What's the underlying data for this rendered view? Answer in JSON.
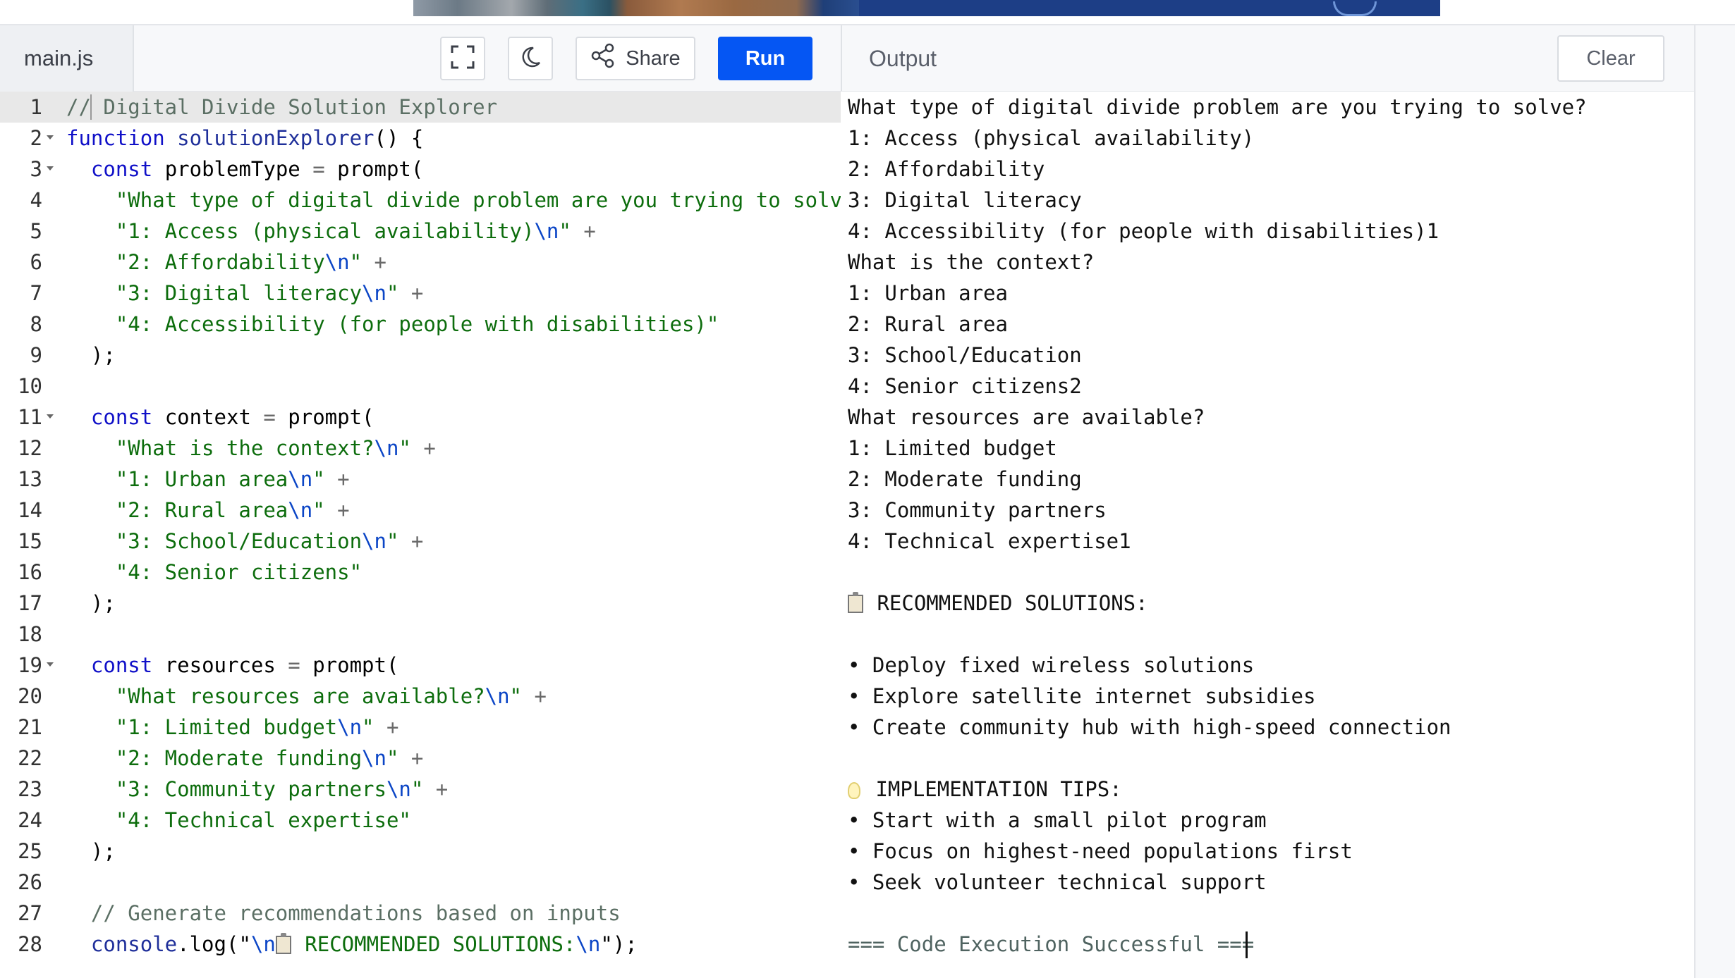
{
  "editor": {
    "file_tab": "main.js",
    "share_label": "Share",
    "run_label": "Run",
    "code_lines": [
      [
        [
          "c",
          "// Digital Divide Solution Explorer"
        ]
      ],
      [
        [
          "k",
          "function "
        ],
        [
          "d",
          "solutionExplorer"
        ],
        [
          "p",
          "() {"
        ]
      ],
      [
        [
          "p",
          "  "
        ],
        [
          "k",
          "const "
        ],
        [
          "p",
          "problemType "
        ],
        [
          "o",
          "= "
        ],
        [
          "p",
          "prompt("
        ]
      ],
      [
        [
          "s",
          "    \"What type of digital divide problem are you trying to solve?\\n\" +"
        ]
      ],
      [
        [
          "s",
          "    \"1: Access (physical availability)"
        ],
        [
          "e",
          "\\n"
        ],
        [
          "s",
          "\" "
        ],
        [
          "o",
          "+"
        ]
      ],
      [
        [
          "s",
          "    \"2: Affordability"
        ],
        [
          "e",
          "\\n"
        ],
        [
          "s",
          "\" "
        ],
        [
          "o",
          "+"
        ]
      ],
      [
        [
          "s",
          "    \"3: Digital literacy"
        ],
        [
          "e",
          "\\n"
        ],
        [
          "s",
          "\" "
        ],
        [
          "o",
          "+"
        ]
      ],
      [
        [
          "s",
          "    \"4: Accessibility (for people with disabilities)\""
        ]
      ],
      [
        [
          "p",
          "  );"
        ]
      ],
      [
        [
          "p",
          ""
        ]
      ],
      [
        [
          "p",
          "  "
        ],
        [
          "k",
          "const "
        ],
        [
          "p",
          "context "
        ],
        [
          "o",
          "= "
        ],
        [
          "p",
          "prompt("
        ]
      ],
      [
        [
          "s",
          "    \"What is the context?"
        ],
        [
          "e",
          "\\n"
        ],
        [
          "s",
          "\" "
        ],
        [
          "o",
          "+"
        ]
      ],
      [
        [
          "s",
          "    \"1: Urban area"
        ],
        [
          "e",
          "\\n"
        ],
        [
          "s",
          "\" "
        ],
        [
          "o",
          "+"
        ]
      ],
      [
        [
          "s",
          "    \"2: Rural area"
        ],
        [
          "e",
          "\\n"
        ],
        [
          "s",
          "\" "
        ],
        [
          "o",
          "+"
        ]
      ],
      [
        [
          "s",
          "    \"3: School/Education"
        ],
        [
          "e",
          "\\n"
        ],
        [
          "s",
          "\" "
        ],
        [
          "o",
          "+"
        ]
      ],
      [
        [
          "s",
          "    \"4: Senior citizens\""
        ]
      ],
      [
        [
          "p",
          "  );"
        ]
      ],
      [
        [
          "p",
          ""
        ]
      ],
      [
        [
          "p",
          "  "
        ],
        [
          "k",
          "const "
        ],
        [
          "p",
          "resources "
        ],
        [
          "o",
          "= "
        ],
        [
          "p",
          "prompt("
        ]
      ],
      [
        [
          "s",
          "    \"What resources are available?"
        ],
        [
          "e",
          "\\n"
        ],
        [
          "s",
          "\" "
        ],
        [
          "o",
          "+"
        ]
      ],
      [
        [
          "s",
          "    \"1: Limited budget"
        ],
        [
          "e",
          "\\n"
        ],
        [
          "s",
          "\" "
        ],
        [
          "o",
          "+"
        ]
      ],
      [
        [
          "s",
          "    \"2: Moderate funding"
        ],
        [
          "e",
          "\\n"
        ],
        [
          "s",
          "\" "
        ],
        [
          "o",
          "+"
        ]
      ],
      [
        [
          "s",
          "    \"3: Community partners"
        ],
        [
          "e",
          "\\n"
        ],
        [
          "s",
          "\" "
        ],
        [
          "o",
          "+"
        ]
      ],
      [
        [
          "s",
          "    \"4: Technical expertise\""
        ]
      ],
      [
        [
          "p",
          "  );"
        ]
      ],
      [
        [
          "p",
          ""
        ]
      ],
      [
        [
          "c",
          "  // Generate recommendations based on inputs"
        ]
      ],
      [
        [
          "p",
          "  "
        ],
        [
          "d",
          "console"
        ],
        [
          "p",
          ".log(\""
        ],
        [
          "e",
          "\\n"
        ],
        [
          "clip",
          ""
        ],
        [
          "s",
          " RECOMMENDED SOLUTIONS:"
        ],
        [
          "e",
          "\\n"
        ],
        [
          "p",
          "\");"
        ]
      ]
    ],
    "foldable_lines": [
      2,
      3,
      11,
      19
    ]
  },
  "output": {
    "title": "Output",
    "clear_label": "Clear",
    "lines": [
      {
        "text": "What type of digital divide problem are you trying to solve?"
      },
      {
        "text": "1: Access (physical availability)"
      },
      {
        "text": "2: Affordability"
      },
      {
        "text": "3: Digital literacy"
      },
      {
        "text": "4: Accessibility (for people with disabilities)1"
      },
      {
        "text": "What is the context?"
      },
      {
        "text": "1: Urban area"
      },
      {
        "text": "2: Rural area"
      },
      {
        "text": "3: School/Education"
      },
      {
        "text": "4: Senior citizens2"
      },
      {
        "text": "What resources are available?"
      },
      {
        "text": "1: Limited budget"
      },
      {
        "text": "2: Moderate funding"
      },
      {
        "text": "3: Community partners"
      },
      {
        "text": "4: Technical expertise1"
      },
      {
        "text": ""
      },
      {
        "text": " RECOMMENDED SOLUTIONS:",
        "icon": "clipboard-icon"
      },
      {
        "text": ""
      },
      {
        "text": "• Deploy fixed wireless solutions"
      },
      {
        "text": "• Explore satellite internet subsidies"
      },
      {
        "text": "• Create community hub with high-speed connection"
      },
      {
        "text": ""
      },
      {
        "text": " IMPLEMENTATION TIPS:",
        "icon": "lightbulb-icon"
      },
      {
        "text": "• Start with a small pilot program"
      },
      {
        "text": "• Focus on highest-need populations first"
      },
      {
        "text": "• Seek volunteer technical support"
      },
      {
        "text": ""
      },
      {
        "text": "=== Code Execution Successful ===",
        "status": "success"
      }
    ]
  },
  "icons": {
    "fullscreen": "fullscreen-icon",
    "theme": "moon-icon",
    "share": "share-icon"
  },
  "colors": {
    "run_button": "#0556f3",
    "keyword": "#1010c8",
    "string": "#0d6d0d",
    "comment": "#5b6f64"
  }
}
